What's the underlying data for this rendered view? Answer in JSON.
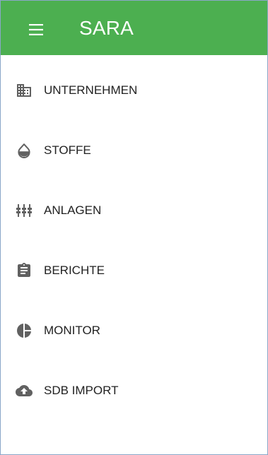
{
  "appbar": {
    "title": "SARA",
    "background_color": "#4caf50",
    "menu_icon": "hamburger-menu-icon"
  },
  "nav": {
    "items": [
      {
        "label": "UNTERNEHMEN",
        "icon": "building-icon"
      },
      {
        "label": "STOFFE",
        "icon": "drop-icon"
      },
      {
        "label": "ANLAGEN",
        "icon": "equipment-icon"
      },
      {
        "label": "BERICHTE",
        "icon": "clipboard-icon"
      },
      {
        "label": "MONITOR",
        "icon": "pie-chart-icon"
      },
      {
        "label": "SDB IMPORT",
        "icon": "cloud-upload-icon"
      }
    ]
  },
  "colors": {
    "accent": "#4caf50",
    "icon": "#616161",
    "text": "#222222",
    "frame_border": "#8aa6c8"
  }
}
